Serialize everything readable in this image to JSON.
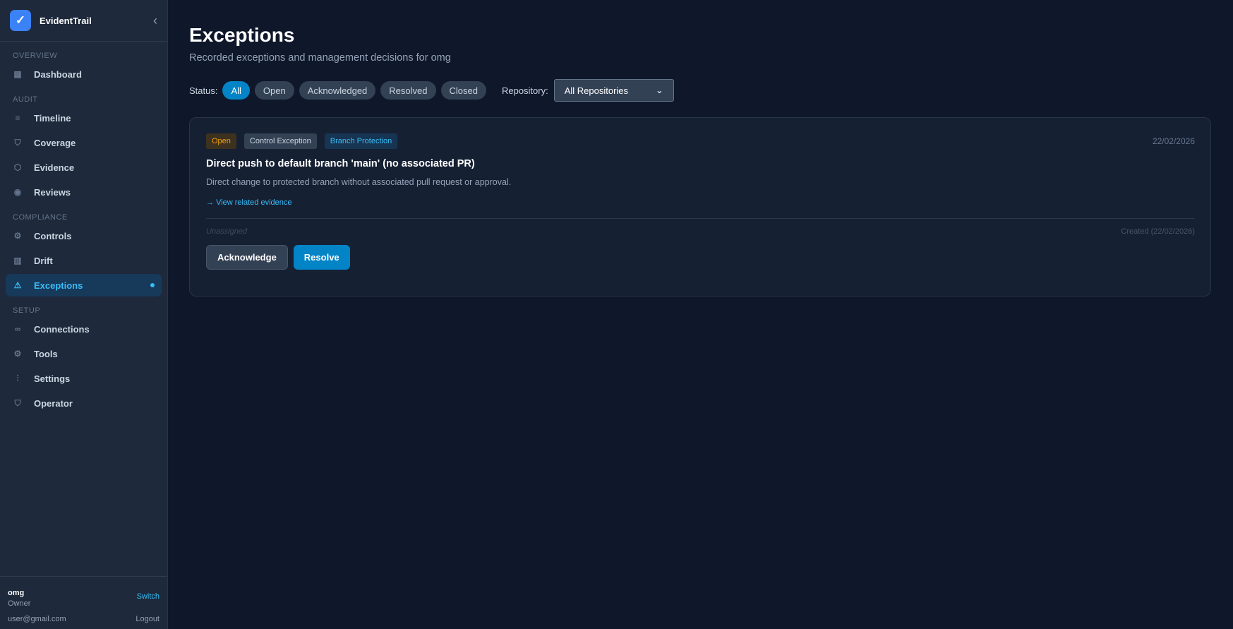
{
  "app": {
    "name": "EvidentTrail"
  },
  "sidebar": {
    "sections": [
      {
        "label": "OVERVIEW",
        "items": [
          {
            "label": "Dashboard",
            "icon": "grid-icon"
          }
        ]
      },
      {
        "label": "AUDIT",
        "items": [
          {
            "label": "Timeline",
            "icon": "lines-icon"
          },
          {
            "label": "Coverage",
            "icon": "shield-icon"
          },
          {
            "label": "Evidence",
            "icon": "box-icon"
          },
          {
            "label": "Reviews",
            "icon": "eye-icon"
          }
        ]
      },
      {
        "label": "COMPLIANCE",
        "items": [
          {
            "label": "Controls",
            "icon": "gear-icon"
          },
          {
            "label": "Drift",
            "icon": "bar-chart-icon"
          },
          {
            "label": "Exceptions",
            "icon": "warning-icon",
            "active": true
          }
        ]
      },
      {
        "label": "SETUP",
        "items": [
          {
            "label": "Connections",
            "icon": "link-icon"
          },
          {
            "label": "Tools",
            "icon": "gear-icon"
          },
          {
            "label": "Settings",
            "icon": "sliders-icon"
          },
          {
            "label": "Operator",
            "icon": "shield-icon"
          }
        ]
      }
    ],
    "footer": {
      "org": "omg",
      "role": "Owner",
      "email": "user@gmail.com",
      "switch": "Switch",
      "logout": "Logout"
    }
  },
  "page": {
    "title": "Exceptions",
    "subtitle": "Recorded exceptions and management decisions for omg"
  },
  "filters": {
    "status_label": "Status:",
    "statuses": [
      "All",
      "Open",
      "Acknowledged",
      "Resolved",
      "Closed"
    ],
    "active": "All",
    "repo_label": "Repository:",
    "repo_value": "All Repositories"
  },
  "exceptions": [
    {
      "status": "Open",
      "type": "Control Exception",
      "category": "Branch Protection",
      "date": "22/02/2026",
      "title": "Direct push to default branch 'main' (no associated PR)",
      "description": "Direct change to protected branch without associated pull request or approval.",
      "link": "View related evidence",
      "assignee": "Unassigned",
      "created": "Created (22/02/2026)",
      "actions": [
        "Acknowledge",
        "Resolve"
      ]
    }
  ],
  "colors": {
    "accent": "#0284c7",
    "open": "#f59e0b",
    "link": "#38bdf8"
  }
}
